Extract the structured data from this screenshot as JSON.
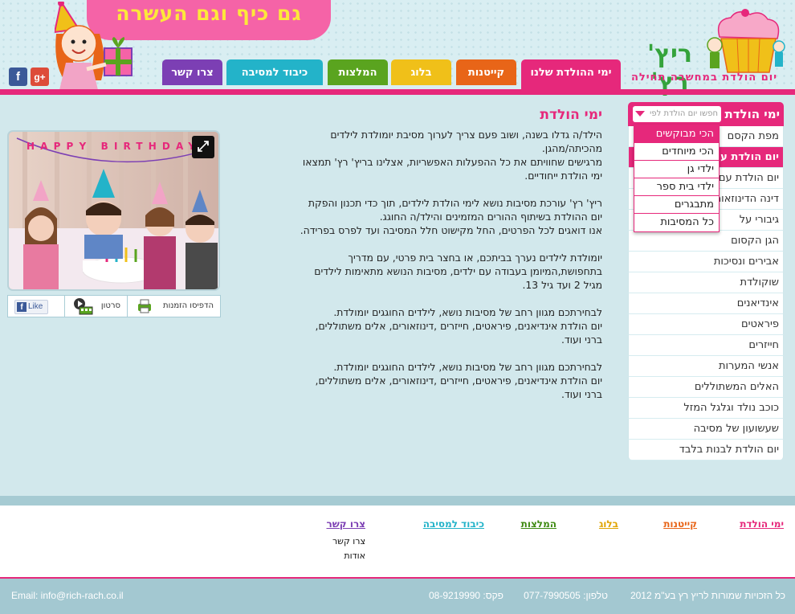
{
  "header": {
    "slogan": "גם כיף וגם העשרה",
    "logo_name": "ריץ' רץ'",
    "logo_tagline": "יום הולדת במחשבה תחילה",
    "social": {
      "facebook": "f",
      "google": "g+"
    }
  },
  "nav": {
    "tabs": [
      {
        "label": "ימי ההולדת שלנו",
        "color": "#e6287b",
        "active": true
      },
      {
        "label": "קייטנות",
        "color": "#e86518"
      },
      {
        "label": "בלוג",
        "color": "#f0c019"
      },
      {
        "label": "המלצות",
        "color": "#5aa41f"
      },
      {
        "label": "כיבוד למסיבה",
        "color": "#23b3c9"
      },
      {
        "label": "צרו קשר",
        "color": "#7c3fb4"
      }
    ]
  },
  "sidebar": {
    "title": "ימי הולדת",
    "filter_placeholder": "חפשו יום הולדת לפי",
    "items": [
      "מפת הקסם",
      "יום הולדת עם הכשפים",
      "יום הולדת עם ליצנים",
      "דינה הדינוזאורית",
      "גיבורי על",
      "הגן הקסום",
      "אבירים ונסיכות",
      "שוקולדת",
      "אינדיאנים",
      "פיראטים",
      "חייזרים",
      "אנשי המערות",
      "האלים המשתוללים",
      "כוכב נולד וגלגל המזל",
      "שעשועון של מסיבה",
      "יום הולדת לבנות בלבד"
    ],
    "highlighted_index": 1
  },
  "dropdown": {
    "options": [
      "הכי מבוקשים",
      "הכי מיוחדים",
      "ילדי גן",
      "ילדי בית ספר",
      "מתבגרים",
      "כל המסיבות"
    ],
    "selected_index": 0
  },
  "main": {
    "title": "ימי הולדת",
    "paragraphs": [
      [
        "הילד/ה גדלו בשנה, ושוב פעם צריך לערוך מסיבת יומולדת לילדים",
        "מהכיתה/מהגן.",
        "מרגישים שחוויתם את כל ההפעלות האפשריות, אצלינו בריץ' רץ' תמצאו",
        "ימי הולדת ייחודיים."
      ],
      [
        "ריץ' רץ' עורכת מסיבות נושא לימי הולדת לילדים, תוך כדי תכנון והפקת",
        "יום ההולדת בשיתוף ההורים המזמינים והילד/ה החוגג.",
        "אנו דואגים לכל הפרטים, החל מקישוט חלל המסיבה ועד לפרס בפרידה."
      ],
      [
        "יומולדת לילדים נערך בביתכם, או בחצר בית פרטי, עם מדריך",
        "בתחפושת,המיומן בעבודה עם ילדים, מסיבות הנושא מתאימות לילדים",
        "מגיל 2 ועד גיל 13."
      ],
      [
        "לבחירתכם מגוון רחב של מסיבות נושא, לילדים החוגגים יומולדת.",
        "יום הולדת אינדיאנים, פיראטים, חייזרים ,דינוזאורים, אלים משתוללים,",
        "ברני ועוד."
      ],
      [
        "לבחירתכם מגוון רחב של מסיבות נושא, לילדים החוגגים יומולדת.",
        "יום הולדת אינדיאנים, פיראטים, חייזרים ,דינוזאורים, אלים משתוללים,",
        "ברני ועוד."
      ]
    ]
  },
  "photo": {
    "banner_letters": "HAPPY BIRTHDAY",
    "toolbar": {
      "print": "הדפיסו הזמנות",
      "video": "סרטון",
      "like": "Like"
    }
  },
  "footer": {
    "columns": [
      {
        "title": "ימי הולדת",
        "color": "#e6287b",
        "links": []
      },
      {
        "title": "קייטנות",
        "color": "#e86518",
        "links": []
      },
      {
        "title": "בלוג",
        "color": "#e0a400",
        "links": []
      },
      {
        "title": "המלצות",
        "color": "#3f8a12",
        "links": []
      },
      {
        "title": "כיבוד למסיבה",
        "color": "#23b3c9",
        "links": []
      },
      {
        "title": "צרו קשר",
        "color": "#7c3fb4",
        "links": [
          "צרו קשר",
          "אודות"
        ]
      }
    ],
    "copyright": "כל הזכויות שמורות לריץ רץ בע\"מ 2012",
    "phone": "טלפון: 077-7990505",
    "fax": "פקס: 08-9219990",
    "email": "Email: info@rich-rach.co.il"
  }
}
